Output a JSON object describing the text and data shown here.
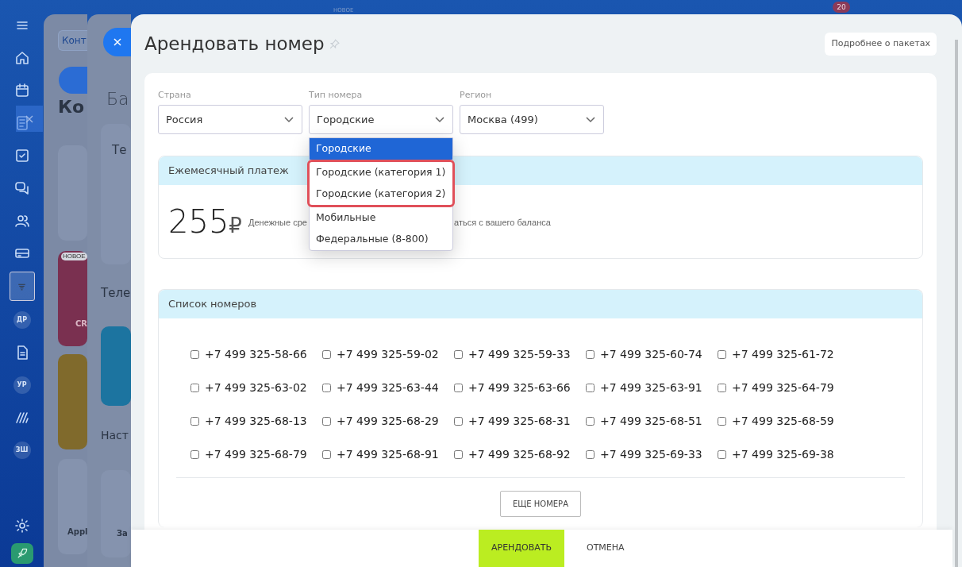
{
  "sidebar": {
    "items": [
      {
        "kind": "menu",
        "selected": false
      },
      {
        "kind": "home",
        "selected": false
      },
      {
        "kind": "calendar",
        "selected": false
      },
      {
        "kind": "feed",
        "selected": false
      },
      {
        "kind": "tasks",
        "selected": false
      },
      {
        "kind": "chat",
        "selected": false
      },
      {
        "kind": "contacts",
        "selected": false
      },
      {
        "kind": "card",
        "selected": false
      },
      {
        "kind": "funnel",
        "selected": true
      },
      {
        "kind": "initials",
        "label": "ДР",
        "selected": false
      },
      {
        "kind": "document",
        "selected": false
      },
      {
        "kind": "initials",
        "label": "УР",
        "selected": false
      },
      {
        "kind": "waves",
        "selected": false
      },
      {
        "kind": "initials",
        "label": "ЗШ",
        "selected": false
      }
    ],
    "bottom": [
      {
        "kind": "gear"
      },
      {
        "kind": "rocket"
      }
    ]
  },
  "top_bar": {
    "new_label": "НОВОЕ",
    "counter": "20"
  },
  "back_panel_1": {
    "tab": "Конт",
    "heading": "Ко",
    "tiles": [
      {
        "kind": "plain"
      },
      {
        "kind": "crimson",
        "label": "CR",
        "badge": "НОВОЕ"
      },
      {
        "kind": "mustard"
      },
      {
        "kind": "plain",
        "label": "Appl"
      }
    ]
  },
  "back_panel_2": {
    "heading": "Ба",
    "card_title": "Те",
    "section_1": "Теле",
    "section_2": "Наст",
    "card_label": "За"
  },
  "dialog": {
    "title": "Арендовать номер",
    "more_button": "Подробнее о пакетах",
    "filters": [
      {
        "label": "Страна",
        "value": "Россия"
      },
      {
        "label": "Тип номера",
        "value": "Городские",
        "open": true
      },
      {
        "label": "Регион",
        "value": "Москва (499)"
      }
    ],
    "dropdown": [
      {
        "label": "Городские",
        "selected": true,
        "highlighted": false
      },
      {
        "label": "Городские (категория 1)",
        "selected": false,
        "highlighted": true
      },
      {
        "label": "Городские (категория 2)",
        "selected": false,
        "highlighted": true
      },
      {
        "label": "Мобильные",
        "selected": false,
        "highlighted": false
      },
      {
        "label": "Федеральные (8-800)",
        "selected": false,
        "highlighted": false
      }
    ],
    "payment": {
      "header": "Ежемесячный платеж",
      "amount": "255",
      "currency": "₽",
      "note_before": "Денежные сре",
      "note_after": "аться с вашего баланса"
    },
    "numbers": {
      "header": "Список номеров",
      "rows": [
        [
          {
            "number": "+7 499 325-58-66",
            "checked": false
          },
          {
            "number": "+7 499 325-59-02",
            "checked": false
          },
          {
            "number": "+7 499 325-59-33",
            "checked": false
          },
          {
            "number": "+7 499 325-60-74",
            "checked": false
          },
          {
            "number": "+7 499 325-61-72",
            "checked": false
          }
        ],
        [
          {
            "number": "+7 499 325-63-02",
            "checked": false
          },
          {
            "number": "+7 499 325-63-44",
            "checked": false
          },
          {
            "number": "+7 499 325-63-66",
            "checked": false
          },
          {
            "number": "+7 499 325-63-91",
            "checked": false
          },
          {
            "number": "+7 499 325-64-79",
            "checked": false
          }
        ],
        [
          {
            "number": "+7 499 325-68-13",
            "checked": false
          },
          {
            "number": "+7 499 325-68-29",
            "checked": false
          },
          {
            "number": "+7 499 325-68-31",
            "checked": false
          },
          {
            "number": "+7 499 325-68-51",
            "checked": false
          },
          {
            "number": "+7 499 325-68-59",
            "checked": false
          }
        ],
        [
          {
            "number": "+7 499 325-68-79",
            "checked": false
          },
          {
            "number": "+7 499 325-68-91",
            "checked": false
          },
          {
            "number": "+7 499 325-68-92",
            "checked": false
          },
          {
            "number": "+7 499 325-69-33",
            "checked": false
          },
          {
            "number": "+7 499 325-69-38",
            "checked": false
          }
        ]
      ],
      "more_button": "ЕЩЕ НОМЕРА"
    },
    "footer": {
      "primary": "АРЕНДОВАТЬ",
      "cancel": "ОТМЕНА"
    }
  }
}
